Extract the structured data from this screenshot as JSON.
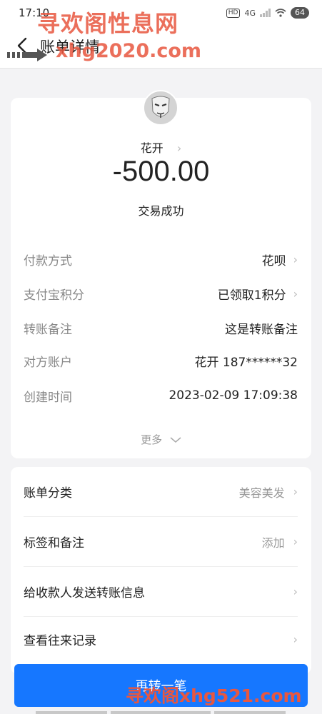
{
  "status_bar": {
    "time": "17:10",
    "hd_badge": "HD",
    "network": "4G",
    "battery": "64"
  },
  "nav": {
    "title": "账单详情"
  },
  "watermarks": {
    "top_line1": "寻欢阁性息网",
    "top_line2": "xhg2020.com",
    "bottom": "寻欢阁xhg521.com"
  },
  "summary": {
    "payee": "花开",
    "amount": "-500.00",
    "status": "交易成功"
  },
  "details": [
    {
      "label": "付款方式",
      "value": "花呗"
    },
    {
      "label": "支付宝积分",
      "value": "已领取1积分"
    },
    {
      "label": "转账备注",
      "value": "这是转账备注"
    },
    {
      "label": "对方账户",
      "value": "花开 187******32"
    },
    {
      "label": "创建时间",
      "value": "2023-02-09 17:09:38"
    }
  ],
  "more_label": "更多",
  "menu": [
    {
      "label": "账单分类",
      "value": "美容美发"
    },
    {
      "label": "标签和备注",
      "value": "添加"
    },
    {
      "label": "给收款人发送转账信息",
      "value": ""
    },
    {
      "label": "查看往来记录",
      "value": ""
    }
  ],
  "bottom_button": {
    "label": "再转一笔"
  },
  "colors": {
    "primary": "#1677ff",
    "watermark": "#e8573f",
    "background": "#f3f3f5"
  }
}
